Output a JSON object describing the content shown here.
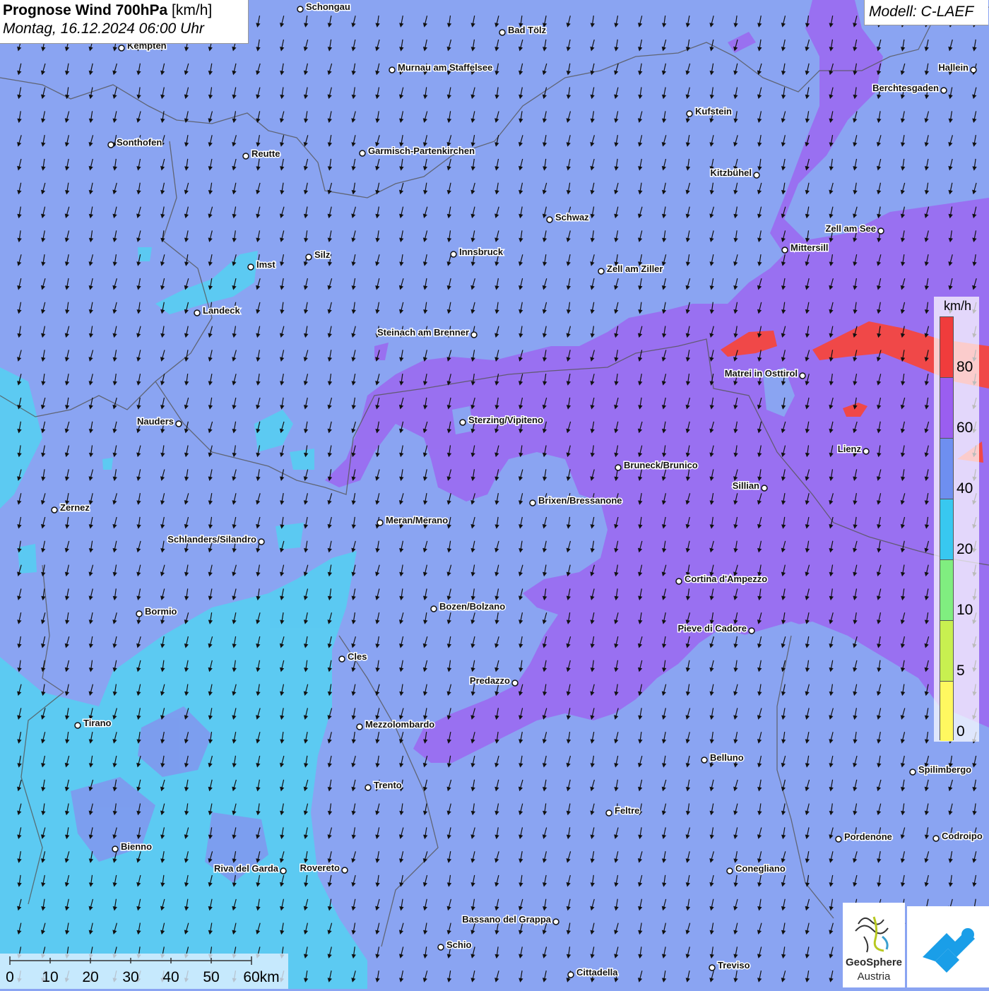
{
  "title": {
    "bold": "Prognose Wind 700hPa",
    "unit": "[km/h]",
    "datetime": "Montag, 16.12.2024 06:00 Uhr"
  },
  "model": "Modell: C-LAEF",
  "wind_field": {
    "direction": "from north (arrows pointing south)"
  },
  "colors": {
    "background_40_60": "#8aa4f2",
    "band_20_40": "#55cdf0",
    "band_60_80": "#9a6ef0",
    "band_80_plus": "#f04848",
    "border": "#555555",
    "arrow": "#111111"
  },
  "legend": {
    "unit": "km/h",
    "labels": [
      "80",
      "60",
      "40",
      "20",
      "10",
      "5",
      "0"
    ],
    "colors": [
      "#f03c3c",
      "#9a5ef0",
      "#6e8ff0",
      "#38c8f0",
      "#80ee80",
      "#c8f050",
      "#fff860"
    ]
  },
  "scalebar": {
    "labels": [
      "0",
      "10",
      "20",
      "30",
      "40",
      "50",
      "60km"
    ]
  },
  "logos": {
    "geosphere_line1": "GeoSphere",
    "geosphere_line2": "Austria"
  },
  "cities": [
    {
      "name": "Schongau",
      "anchor": "start"
    },
    {
      "name": "Bad Tölz",
      "anchor": "start"
    },
    {
      "name": "Kempten",
      "anchor": "start"
    },
    {
      "name": "Murnau am Staffelsee",
      "anchor": "start"
    },
    {
      "name": "Hallein",
      "anchor": "end"
    },
    {
      "name": "Berchtesgaden",
      "anchor": "end"
    },
    {
      "name": "Kufstein",
      "anchor": "start"
    },
    {
      "name": "Sonthofen",
      "anchor": "start"
    },
    {
      "name": "Reutte",
      "anchor": "start"
    },
    {
      "name": "Garmisch-Partenkirchen",
      "anchor": "start"
    },
    {
      "name": "Kitzbühel",
      "anchor": "end"
    },
    {
      "name": "Schwaz",
      "anchor": "start"
    },
    {
      "name": "Zell am See",
      "anchor": "end"
    },
    {
      "name": "Mittersill",
      "anchor": "start"
    },
    {
      "name": "Innsbruck",
      "anchor": "start"
    },
    {
      "name": "Silz",
      "anchor": "start"
    },
    {
      "name": "Imst",
      "anchor": "start"
    },
    {
      "name": "Zell am Ziller",
      "anchor": "start"
    },
    {
      "name": "Landeck",
      "anchor": "start"
    },
    {
      "name": "Steinach am Brenner",
      "anchor": "end"
    },
    {
      "name": "Matrei in Osttirol",
      "anchor": "end"
    },
    {
      "name": "Nauders",
      "anchor": "end"
    },
    {
      "name": "Sterzing/Vipiteno",
      "anchor": "start"
    },
    {
      "name": "Lienz",
      "anchor": "end"
    },
    {
      "name": "Bruneck/Brunico",
      "anchor": "start"
    },
    {
      "name": "Sillian",
      "anchor": "end"
    },
    {
      "name": "Brixen/Bressanone",
      "anchor": "start"
    },
    {
      "name": "Zernez",
      "anchor": "start"
    },
    {
      "name": "Meran/Merano",
      "anchor": "start"
    },
    {
      "name": "Schlanders/Silandro",
      "anchor": "end"
    },
    {
      "name": "Cortina d'Ampezzo",
      "anchor": "start"
    },
    {
      "name": "Bozen/Bolzano",
      "anchor": "start"
    },
    {
      "name": "Bormio",
      "anchor": "start"
    },
    {
      "name": "Pieve di Cadore",
      "anchor": "end"
    },
    {
      "name": "Cles",
      "anchor": "start"
    },
    {
      "name": "Predazzo",
      "anchor": "end"
    },
    {
      "name": "Tirano",
      "anchor": "start"
    },
    {
      "name": "Mezzolombardo",
      "anchor": "start"
    },
    {
      "name": "Belluno",
      "anchor": "start"
    },
    {
      "name": "Spilimbergo",
      "anchor": "start"
    },
    {
      "name": "Trento",
      "anchor": "start"
    },
    {
      "name": "Feltre",
      "anchor": "start"
    },
    {
      "name": "Pordenone",
      "anchor": "start"
    },
    {
      "name": "Codroipo",
      "anchor": "start"
    },
    {
      "name": "Bienno",
      "anchor": "start"
    },
    {
      "name": "Riva del Garda",
      "anchor": "end"
    },
    {
      "name": "Rovereto",
      "anchor": "end"
    },
    {
      "name": "Conegliano",
      "anchor": "start"
    },
    {
      "name": "Bassano del Grappa",
      "anchor": "end"
    },
    {
      "name": "Schio",
      "anchor": "start"
    },
    {
      "name": "Treviso",
      "anchor": "start"
    },
    {
      "name": "Cittadella",
      "anchor": "start"
    }
  ]
}
